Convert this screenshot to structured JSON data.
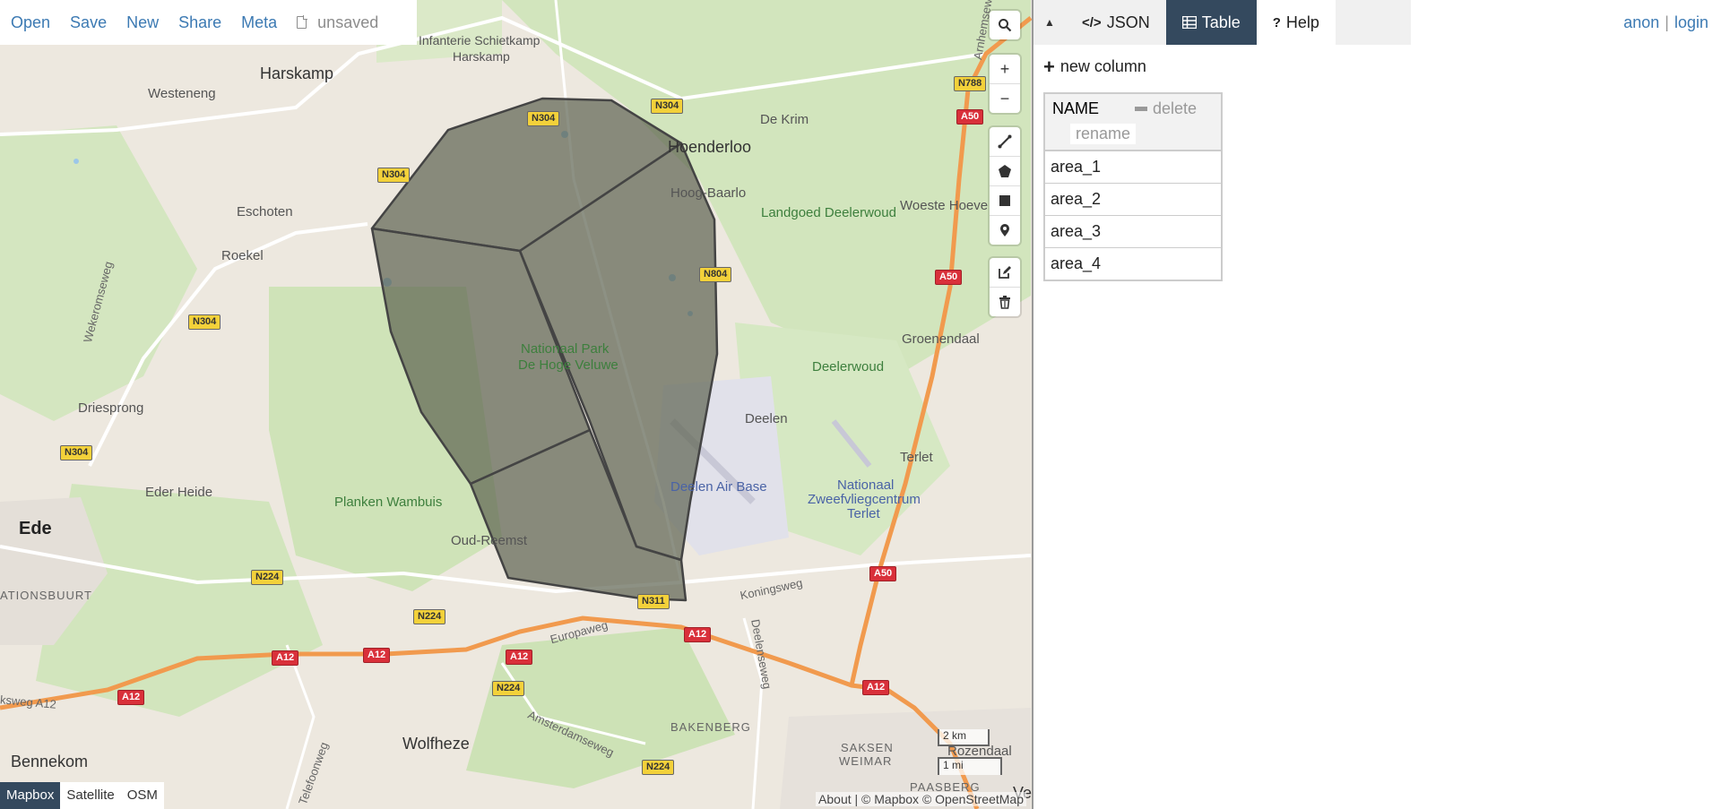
{
  "menu": {
    "open": "Open",
    "save": "Save",
    "new": "New",
    "share": "Share",
    "meta": "Meta",
    "file_status": "unsaved"
  },
  "controls": {
    "search_icon": "search-icon",
    "zoom_in": "+",
    "zoom_out": "−"
  },
  "draw_tools": [
    "line-icon",
    "polygon-icon",
    "rectangle-icon",
    "marker-icon"
  ],
  "edit_tools": [
    "edit-icon",
    "trash-icon"
  ],
  "map": {
    "places": {
      "harskamp": "Harskamp",
      "westeneng": "Westeneng",
      "infanterie": "Infanterie Schietkamp",
      "infanterie2": "Harskamp",
      "eschoten": "Eschoten",
      "roekel": "Roekel",
      "wekeromseweg": "Wekeromseweg",
      "driesprong": "Driesprong",
      "eder_heide": "Eder Heide",
      "ede": "Ede",
      "ationsbuurt": "ATIONSBUURT",
      "de_krim": "De Krim",
      "hoenderloo": "Hoenderloo",
      "hoog_baarlo": "Hoog-Baarlo",
      "landgoed": "Landgoed Deelerwoud",
      "woeste_hoeve": "Woeste Hoeve",
      "arnhemseweg": "Arnhemseweg",
      "np1": "Nationaal Park",
      "np2": "De Hoge Veluwe",
      "deelerwoud": "Deelerwoud",
      "groenendaal": "Groenendaal",
      "deelen": "Deelen",
      "terlet": "Terlet",
      "deelen_air": "Deelen Air Base",
      "zweef1": "Nationaal",
      "zweef2": "Zweefvliegcentrum",
      "zweef3": "Terlet",
      "planken": "Planken Wambuis",
      "oud_reemst": "Oud-Reemst",
      "koningsweg": "Koningsweg",
      "europaweg": "Europaweg",
      "deelenseweg": "Deelenseweg",
      "amsterdamseweg": "Amsterdamseweg",
      "bakenberg": "BAKENBERG",
      "saksen1": "SAKSEN",
      "saksen2": "WEIMAR",
      "paasberg": "PAASBERG",
      "rozendaal": "Rozendaal",
      "wolfheze": "Wolfheze",
      "bennekom": "Bennekom",
      "telefoonweg": "Telefoonweg",
      "ksweg": "ksweg A12",
      "ve": "Ve"
    },
    "shields": {
      "n304": "N304",
      "n788": "N788",
      "a50": "A50",
      "n804": "N804",
      "n224": "N224",
      "n311": "N311",
      "a12": "A12"
    },
    "scale_km": "2 km",
    "scale_mi": "1 mi",
    "layers": [
      "Mapbox",
      "Satellite",
      "OSM"
    ],
    "active_layer": "Mapbox",
    "attribution": "About | © Mapbox © OpenStreetMap"
  },
  "sidebar": {
    "collapse_icon": "▲",
    "tabs": {
      "json": "JSON",
      "table": "Table",
      "help": "Help"
    },
    "active_tab": "Table",
    "user": {
      "anon": "anon",
      "separator": "|",
      "login": "login"
    },
    "new_column": "new column",
    "table": {
      "column": "NAME",
      "delete": "delete",
      "rename": "rename",
      "rows": [
        "area_1",
        "area_2",
        "area_3",
        "area_4"
      ]
    }
  },
  "colors": {
    "accent_link": "#3c7ab3",
    "active_tab": "#34495e",
    "polygon_fill": "#5d6350"
  }
}
